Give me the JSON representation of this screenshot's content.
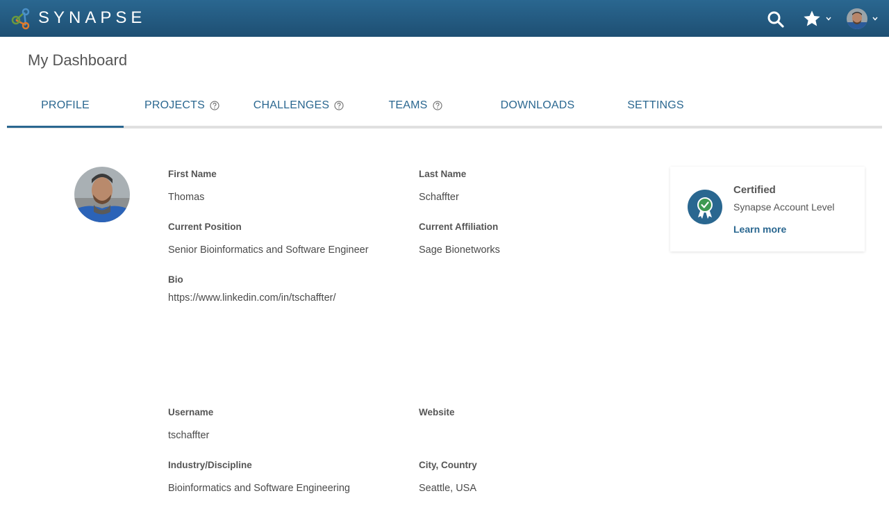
{
  "header": {
    "brand": "SYNAPSE",
    "accent": "#2a6790"
  },
  "page": {
    "title": "My Dashboard"
  },
  "tabs": [
    {
      "label": "PROFILE",
      "active": true,
      "help": false
    },
    {
      "label": "PROJECTS",
      "active": false,
      "help": true
    },
    {
      "label": "CHALLENGES",
      "active": false,
      "help": true
    },
    {
      "label": "TEAMS",
      "active": false,
      "help": true
    },
    {
      "label": "DOWNLOADS",
      "active": false,
      "help": false
    },
    {
      "label": "SETTINGS",
      "active": false,
      "help": false
    }
  ],
  "profile": {
    "first_name_label": "First Name",
    "first_name": "Thomas",
    "last_name_label": "Last Name",
    "last_name": "Schaffter",
    "position_label": "Current Position",
    "position": "Senior Bioinformatics and Software Engineer",
    "affiliation_label": "Current Affiliation",
    "affiliation": "Sage Bionetworks",
    "bio_label": "Bio",
    "bio": "https://www.linkedin.com/in/tschaffter/",
    "username_label": "Username",
    "username": "tschaffter",
    "website_label": "Website",
    "website": "",
    "industry_label": "Industry/Discipline",
    "industry": "Bioinformatics and Software Engineering",
    "location_label": "City, Country",
    "location": "Seattle, USA"
  },
  "certification": {
    "title": "Certified",
    "subtitle": "Synapse Account Level",
    "link": "Learn more"
  }
}
